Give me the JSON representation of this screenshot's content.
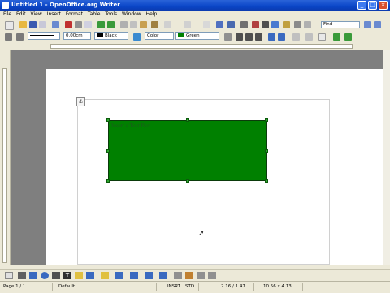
{
  "window": {
    "title": "Untitled 1 - OpenOffice.org Writer"
  },
  "menu": {
    "items": [
      "File",
      "Edit",
      "View",
      "Insert",
      "Format",
      "Table",
      "Tools",
      "Window",
      "Help"
    ]
  },
  "toolbar_search": {
    "value": "Find"
  },
  "formatting": {
    "line_width": "0.00cm",
    "line_color": "Black",
    "area_style": "Color",
    "area_color": "Green"
  },
  "document": {
    "textbox_text": "Insert a Text Box",
    "textbox_color": "#008000"
  },
  "status": {
    "page": "Page 1 / 1",
    "style": "Default",
    "insert_mode": "INSRT",
    "selection_mode": "STD",
    "position": "2.16 / 1.47",
    "size": "10.56 x 4.13"
  },
  "icons": {
    "app": "writer-app-icon",
    "anchor": "anchor-icon"
  }
}
